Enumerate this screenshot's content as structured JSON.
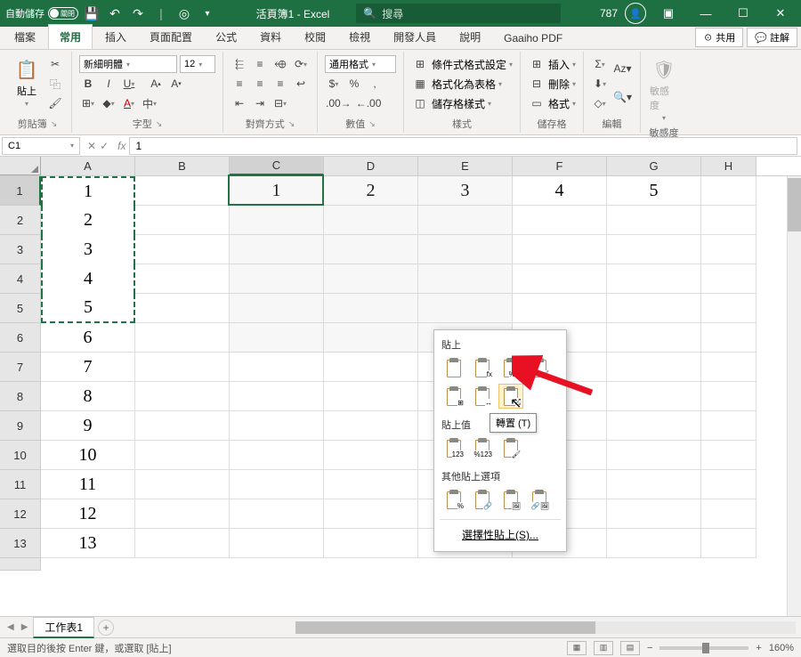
{
  "titlebar": {
    "autosave": "自動儲存",
    "toggle": "關閉",
    "doc": "活頁簿1 - Excel",
    "search_ph": "搜尋",
    "user": "787"
  },
  "tabs": [
    "檔案",
    "常用",
    "插入",
    "頁面配置",
    "公式",
    "資料",
    "校閱",
    "檢視",
    "開發人員",
    "說明",
    "Gaaiho PDF"
  ],
  "active_tab": 1,
  "share": {
    "share": "共用",
    "comment": "註解"
  },
  "ribbon": {
    "clipboard": {
      "paste": "貼上",
      "label": "剪貼簿"
    },
    "font": {
      "name": "新細明體",
      "size": "12",
      "label": "字型",
      "b": "B",
      "i": "I",
      "u": "U",
      "ph": "中"
    },
    "align": {
      "label": "對齊方式"
    },
    "number": {
      "format": "通用格式",
      "label": "數值"
    },
    "styles": {
      "cond": "條件式格式設定",
      "table": "格式化為表格",
      "cell": "儲存格樣式",
      "label": "樣式"
    },
    "cells": {
      "insert": "插入",
      "delete": "刪除",
      "format": "格式",
      "label": "儲存格"
    },
    "editing": {
      "label": "編輯"
    },
    "sens": {
      "btn": "敏感度",
      "label": "敏感度"
    }
  },
  "namebox": "C1",
  "formula": "1",
  "columns": [
    "A",
    "B",
    "C",
    "D",
    "E",
    "F",
    "G",
    "H"
  ],
  "rows": [
    1,
    2,
    3,
    4,
    5,
    6,
    7,
    8,
    9,
    10,
    11,
    12,
    13
  ],
  "colA": [
    "1",
    "2",
    "3",
    "4",
    "5",
    "6",
    "7",
    "8",
    "9",
    "10",
    "11",
    "12",
    "13"
  ],
  "row1": [
    "",
    "1",
    "2",
    "3",
    "4",
    "5",
    ""
  ],
  "context": {
    "paste": "貼上",
    "paste_values": "貼上值",
    "other": "其他貼上選項",
    "special": "選擇性貼上(S)...",
    "tooltip": "轉置 (T)"
  },
  "sheet": "工作表1",
  "status": "選取目的後按 Enter 鍵，或選取 [貼上]",
  "zoom": "160%"
}
